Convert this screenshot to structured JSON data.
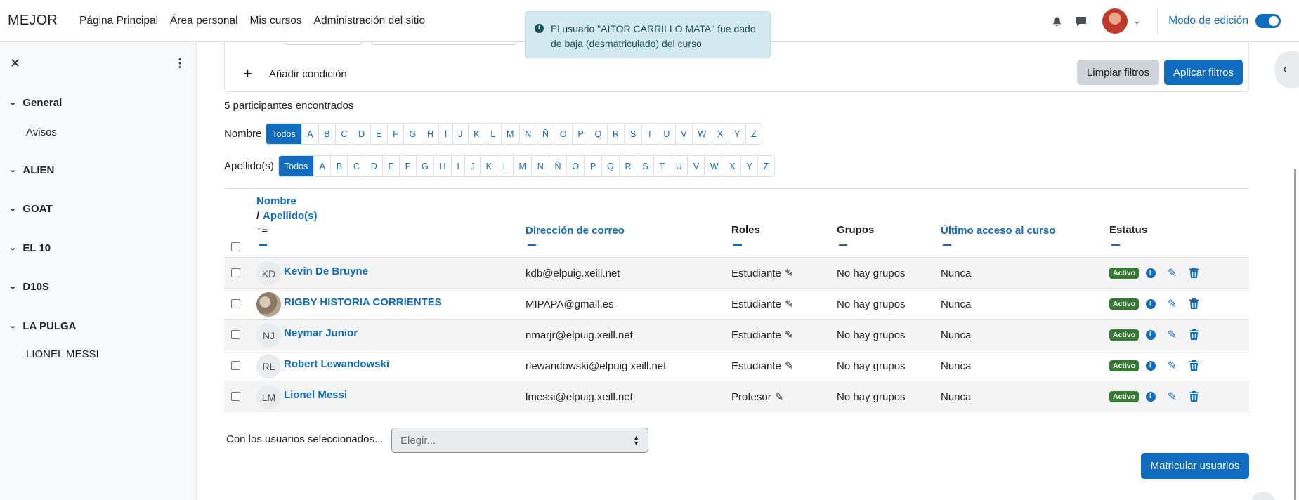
{
  "navbar": {
    "brand": "MEJOR",
    "links": [
      "Página Principal",
      "Área personal",
      "Mis cursos",
      "Administración del sitio"
    ],
    "edit_mode_label": "Modo de edición"
  },
  "toast": {
    "message": "El usuario \"AITOR CARRILLO MATA\" fue dado de baja (desmatriculado) del curso"
  },
  "sidebar": {
    "sections": [
      {
        "label": "General",
        "items": [
          "Avisos"
        ]
      },
      {
        "label": "ALIEN",
        "items": []
      },
      {
        "label": "GOAT",
        "items": []
      },
      {
        "label": "EL 10",
        "items": []
      },
      {
        "label": "D10S",
        "items": []
      },
      {
        "label": "LA PULGA",
        "items": [
          "LIONEL MESSI"
        ]
      }
    ]
  },
  "filters": {
    "add_condition": "Añadir condición",
    "clear_label": "Limpiar filtros",
    "apply_label": "Aplicar filtros"
  },
  "participants_count": "5 participantes encontrados",
  "initials_filter": {
    "first_name_label": "Nombre",
    "last_name_label": "Apellido(s)",
    "all_label": "Todos",
    "letters": [
      "A",
      "B",
      "C",
      "D",
      "E",
      "F",
      "G",
      "H",
      "I",
      "J",
      "K",
      "L",
      "M",
      "N",
      "Ñ",
      "O",
      "P",
      "Q",
      "R",
      "S",
      "T",
      "U",
      "V",
      "W",
      "X",
      "Y",
      "Z"
    ]
  },
  "table": {
    "headers": {
      "first_name": "Nombre",
      "separator": "/",
      "last_name": "Apellido(s)",
      "email": "Dirección de correo",
      "roles": "Roles",
      "groups": "Grupos",
      "last_access": "Último acceso al curso",
      "status": "Estatus"
    },
    "rows": [
      {
        "initials": "KD",
        "name": "Kevin De Bruyne",
        "email": "kdb@elpuig.xeill.net",
        "role": "Estudiante",
        "groups": "No hay grupos",
        "last_access": "Nunca",
        "status": "Activo"
      },
      {
        "initials": "",
        "name": "RIGBY HISTORIA CORRIENTES",
        "email": "MIPAPA@gmail.es",
        "role": "Estudiante",
        "groups": "No hay grupos",
        "last_access": "Nunca",
        "status": "Activo"
      },
      {
        "initials": "NJ",
        "name": "Neymar Junior",
        "email": "nmarjr@elpuig.xeill.net",
        "role": "Estudiante",
        "groups": "No hay grupos",
        "last_access": "Nunca",
        "status": "Activo"
      },
      {
        "initials": "RL",
        "name": "Robert Lewandowski",
        "email": "rlewandowski@elpuig.xeill.net",
        "role": "Estudiante",
        "groups": "No hay grupos",
        "last_access": "Nunca",
        "status": "Activo"
      },
      {
        "initials": "LM",
        "name": "Lionel Messi",
        "email": "lmessi@elpuig.xeill.net",
        "role": "Profesor",
        "groups": "No hay grupos",
        "last_access": "Nunca",
        "status": "Activo"
      }
    ]
  },
  "bulk": {
    "label": "Con los usuarios seleccionados...",
    "select_value": "Elegir..."
  },
  "enrol_button": "Matricular usuarios",
  "icons": {
    "pencil": "✎",
    "info": "i",
    "trash": "trash-icon"
  }
}
